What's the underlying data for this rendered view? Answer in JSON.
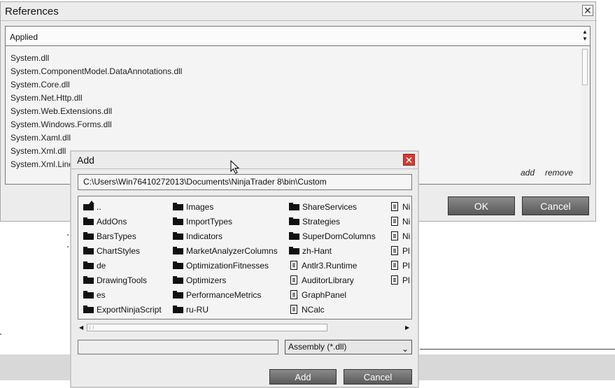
{
  "references": {
    "title": "References",
    "dropdown_value": "Applied",
    "items": [
      "System.dll",
      "System.ComponentModel.DataAnnotations.dll",
      "System.Core.dll",
      "System.Net.Http.dll",
      "System.Web.Extensions.dll",
      "System.Windows.Forms.dll",
      "System.Xaml.dll",
      "System.Xml.dll",
      "System.Xml.Linq.dll"
    ],
    "add_link": "add",
    "remove_link": "remove",
    "ok_label": "OK",
    "cancel_label": "Cancel",
    "close_glyph": "✕"
  },
  "add_dialog": {
    "title": "Add",
    "close_glyph": "✕",
    "path": "C:\\Users\\Win76410272013\\Documents\\NinjaTrader 8\\bin\\Custom",
    "file_name": "",
    "filter": "Assembly (*.dll)",
    "add_label": "Add",
    "cancel_label": "Cancel",
    "columns": [
      [
        {
          "name": "..",
          "icon": "folder-up-icon"
        },
        {
          "name": "AddOns",
          "icon": "folder-icon"
        },
        {
          "name": "BarsTypes",
          "icon": "folder-icon"
        },
        {
          "name": "ChartStyles",
          "icon": "folder-icon"
        },
        {
          "name": "de",
          "icon": "folder-icon"
        },
        {
          "name": "DrawingTools",
          "icon": "folder-icon"
        },
        {
          "name": "es",
          "icon": "folder-icon"
        },
        {
          "name": "ExportNinjaScript",
          "icon": "folder-icon"
        }
      ],
      [
        {
          "name": "Images",
          "icon": "folder-icon"
        },
        {
          "name": "ImportTypes",
          "icon": "folder-icon"
        },
        {
          "name": "Indicators",
          "icon": "folder-icon"
        },
        {
          "name": "MarketAnalyzerColumns",
          "icon": "folder-icon"
        },
        {
          "name": "OptimizationFitnesses",
          "icon": "folder-icon"
        },
        {
          "name": "Optimizers",
          "icon": "folder-icon"
        },
        {
          "name": "PerformanceMetrics",
          "icon": "folder-icon"
        },
        {
          "name": "ru-RU",
          "icon": "folder-icon"
        }
      ],
      [
        {
          "name": "ShareServices",
          "icon": "folder-icon"
        },
        {
          "name": "Strategies",
          "icon": "folder-icon"
        },
        {
          "name": "SuperDomColumns",
          "icon": "folder-icon"
        },
        {
          "name": "zh-Hant",
          "icon": "folder-icon"
        },
        {
          "name": "Antlr3.Runtime",
          "icon": "document-icon"
        },
        {
          "name": "AuditorLibrary",
          "icon": "document-icon"
        },
        {
          "name": "GraphPanel",
          "icon": "document-icon"
        },
        {
          "name": "NCalc",
          "icon": "document-icon"
        }
      ],
      [
        {
          "name": "Ni",
          "icon": "document-icon"
        },
        {
          "name": "Ni",
          "icon": "document-icon"
        },
        {
          "name": "Ni",
          "icon": "document-icon"
        },
        {
          "name": "Pl",
          "icon": "document-icon"
        },
        {
          "name": "Pl",
          "icon": "document-icon"
        },
        {
          "name": "Pl",
          "icon": "document-icon"
        }
      ]
    ]
  }
}
